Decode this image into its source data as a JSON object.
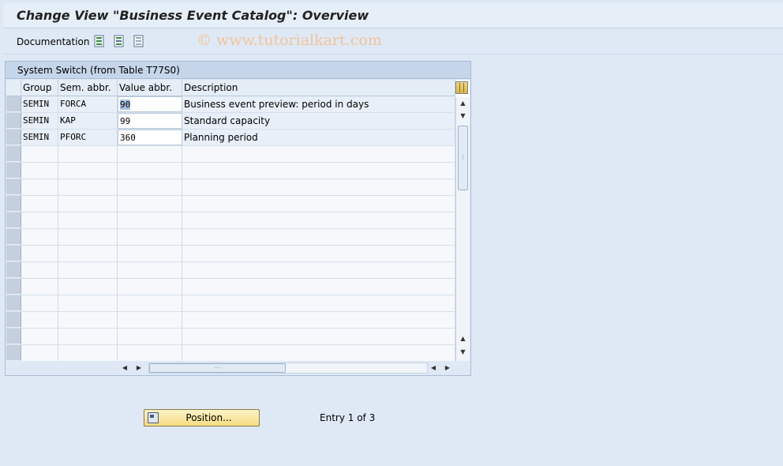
{
  "window": {
    "title": "Change View \"Business Event Catalog\": Overview"
  },
  "toolbar": {
    "documentation_label": "Documentation",
    "icons": [
      "select-all-icon",
      "select-block-icon",
      "deselect-all-icon"
    ],
    "watermark": "© www.tutorialkart.com"
  },
  "panel": {
    "title": "System Switch (from Table T77S0)"
  },
  "table": {
    "columns": [
      "Group",
      "Sem. abbr.",
      "Value abbr.",
      "Description"
    ],
    "rows": [
      {
        "group": "SEMIN",
        "sem": "FORCA",
        "value": "90",
        "desc": "Business event preview: period in days"
      },
      {
        "group": "SEMIN",
        "sem": "KAP",
        "value": "99",
        "desc": "Standard capacity"
      },
      {
        "group": "SEMIN",
        "sem": "PFORC",
        "value": "360",
        "desc": "Planning period"
      }
    ]
  },
  "footer": {
    "position_button": "Position...",
    "entry_text": "Entry 1 of 3"
  },
  "colors": {
    "background": "#dfe9f5",
    "button": "#f6dc82",
    "selection": "#a9c2e2"
  }
}
